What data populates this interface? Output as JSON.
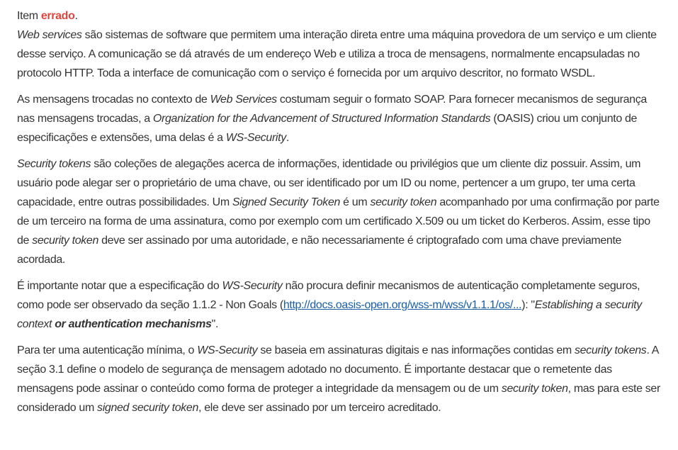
{
  "verdict": {
    "prefix": "Item ",
    "value": "errado",
    "suffix": "."
  },
  "p1": {
    "s0": "Web services",
    "s1": " são sistemas de software que permitem uma interação direta entre uma máquina provedora de um serviço e um cliente desse serviço. A comunicação se dá através de um endereço Web e utiliza a troca de mensagens, normalmente encapsuladas no protocolo HTTP. Toda a interface de comunicação com o serviço é fornecida por um arquivo descritor, no formato WSDL."
  },
  "p2": {
    "s0": "As mensagens trocadas no contexto de ",
    "s1": "Web Services",
    "s2": " costumam seguir o formato SOAP. Para fornecer mecanismos de segurança nas mensagens trocadas, a ",
    "s3": "Organization for the Advancement of Structured Information Standards",
    "s4": " (OASIS) criou um conjunto de especificações e extensões, uma delas é a ",
    "s5": "WS-Security",
    "s6": "."
  },
  "p3": {
    "s0": "Security tokens",
    "s1": " são coleções de alegações acerca de informações, identidade ou privilégios que um cliente diz possuir. Assim, um usuário pode alegar ser o proprietário de uma chave, ou ser identificado por um ID ou nome, pertencer a um grupo, ter uma certa capacidade, entre outras possibilidades. Um ",
    "s2": "Signed Security Token",
    "s3": " é um ",
    "s4": "security token",
    "s5": " acompanhado por uma confirmação por parte de um terceiro na forma de uma assinatura, como por exemplo com um certificado X.509 ou um ticket do Kerberos. Assim, esse tipo de ",
    "s6": "security token",
    "s7": " deve ser assinado por uma autoridade, e não necessariamente é criptografado com uma chave previamente acordada."
  },
  "p4": {
    "s0": "É importante notar que a especificação do ",
    "s1": "WS-Security",
    "s2": " não procura definir mecanismos de autenticação completamente seguros, como pode ser observado da seção 1.1.2 - Non Goals (",
    "link": "http://docs.oasis-open.org/wss-m/wss/v1.1.1/os/...",
    "s3": "): \"",
    "s4": "Establishing a security context ",
    "s5": "or authentication mechanisms",
    "s6": "\"."
  },
  "p5": {
    "s0": "Para ter uma autenticação mínima, o ",
    "s1": "WS-Security",
    "s2": " se baseia em assinaturas digitais e nas informações contidas em ",
    "s3": "security tokens",
    "s4": ". A seção 3.1 define o modelo de segurança de mensagem adotado no documento. É importante destacar que o remetente das mensagens pode assinar o conteúdo como forma de proteger a integridade da mensagem ou de um ",
    "s5": "security token",
    "s6": ", mas para este ser considerado um ",
    "s7": "signed security token",
    "s8": ", ele deve ser assinado por um terceiro acreditado."
  }
}
